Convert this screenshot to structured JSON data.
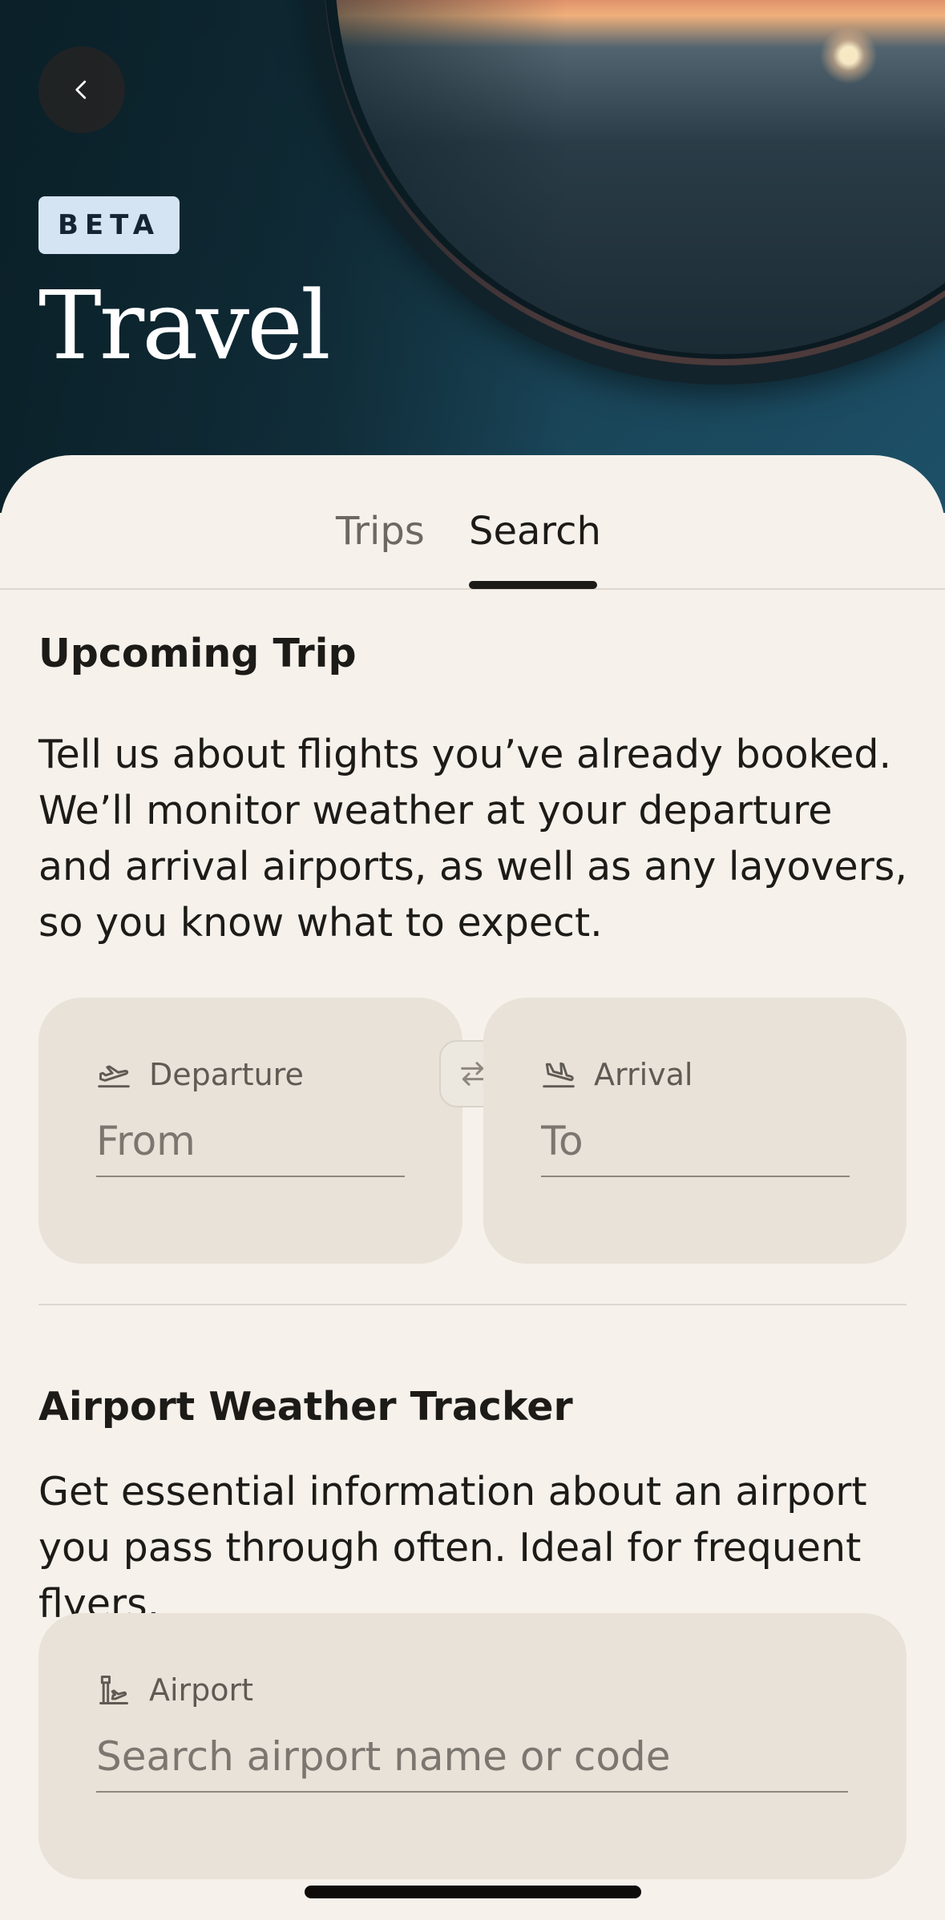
{
  "header": {
    "back_icon": "chevron-left-icon",
    "badge": "BETA",
    "title": "Travel"
  },
  "tabs": [
    {
      "label": "Trips",
      "active": false
    },
    {
      "label": "Search",
      "active": true
    }
  ],
  "upcoming_trip": {
    "title": "Upcoming Trip",
    "description": "Tell us about flights you’ve already booked. We’ll monitor weather at your departure and arrival airports, as well as any layovers, so you know what to expect.",
    "departure": {
      "label": "Departure",
      "placeholder": "From",
      "icon": "plane-takeoff-icon"
    },
    "swap_icon": "swap-arrows-icon",
    "arrival": {
      "label": "Arrival",
      "placeholder": "To",
      "icon": "plane-landing-icon"
    }
  },
  "airport_tracker": {
    "title": "Airport Weather Tracker",
    "description": "Get essential information about an airport you pass through often. Ideal for frequent flyers.",
    "airport": {
      "label": "Airport",
      "placeholder": "Search airport name or code",
      "icon": "control-tower-icon"
    }
  },
  "colors": {
    "background": "#f6f1eb",
    "card": "#e8e2d8",
    "badge": "#d5e4f2",
    "text": "#1d1b18"
  }
}
